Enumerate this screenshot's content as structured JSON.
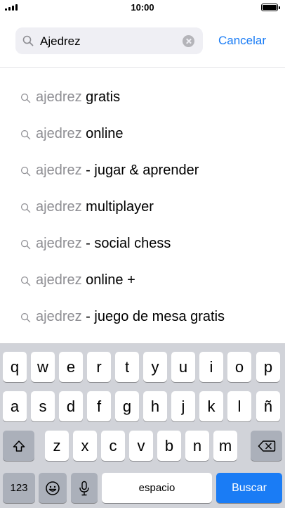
{
  "status_bar": {
    "time": "10:00"
  },
  "search": {
    "query": "Ajedrez",
    "cancel_label": "Cancelar"
  },
  "suggestions": [
    {
      "prefix": "ajedrez",
      "suffix": " gratis"
    },
    {
      "prefix": "ajedrez",
      "suffix": " online"
    },
    {
      "prefix": "ajedrez",
      "suffix": " - jugar & aprender"
    },
    {
      "prefix": "ajedrez",
      "suffix": " multiplayer"
    },
    {
      "prefix": "ajedrez",
      "suffix": " - social chess"
    },
    {
      "prefix": "ajedrez",
      "suffix": " online +"
    },
    {
      "prefix": "ajedrez",
      "suffix": " - juego de mesa gratis"
    }
  ],
  "keyboard": {
    "row1": [
      "q",
      "w",
      "e",
      "r",
      "t",
      "y",
      "u",
      "i",
      "o",
      "p"
    ],
    "row2": [
      "a",
      "s",
      "d",
      "f",
      "g",
      "h",
      "j",
      "k",
      "l",
      "ñ"
    ],
    "row3": [
      "z",
      "x",
      "c",
      "v",
      "b",
      "n",
      "m"
    ],
    "numbers_label": "123",
    "space_label": "espacio",
    "search_label": "Buscar",
    "shift_icon": "shift-icon",
    "delete_icon": "delete-icon",
    "emoji_icon": "emoji-icon",
    "mic_icon": "microphone-icon",
    "accent_color": "#1a7cf5"
  }
}
